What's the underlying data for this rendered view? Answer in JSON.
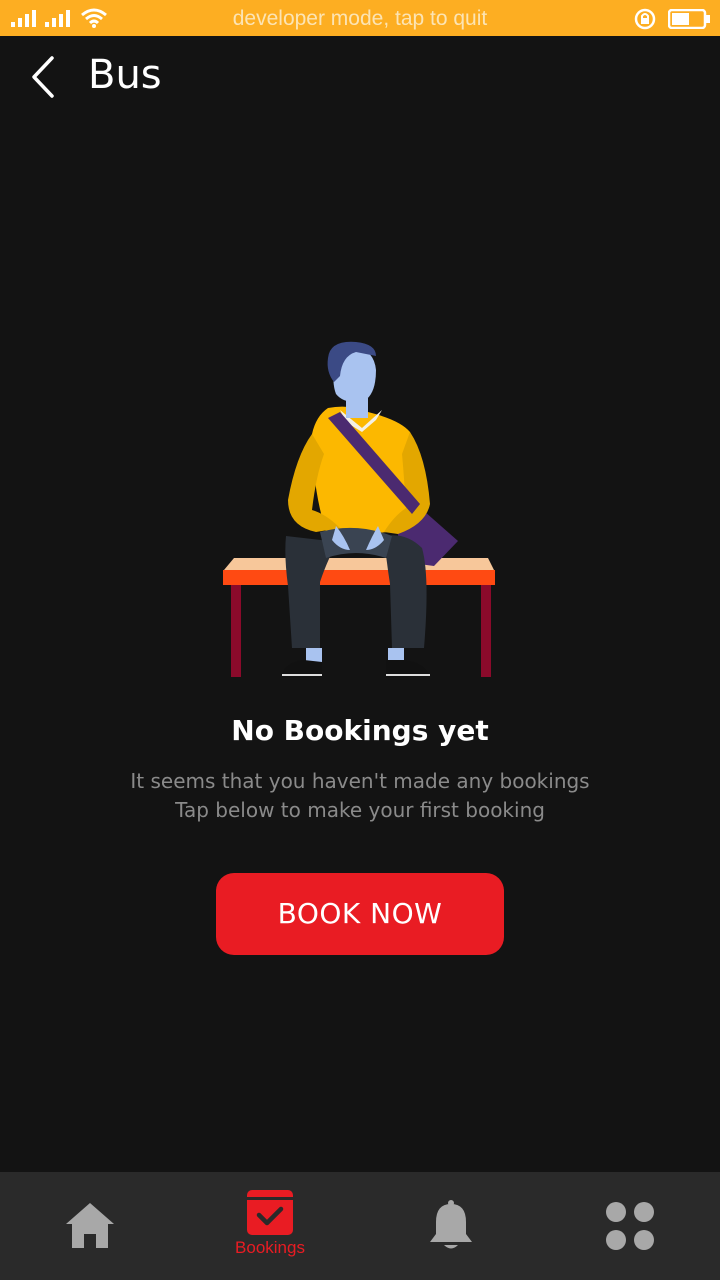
{
  "status_bar": {
    "message": "developer mode, tap to quit",
    "background": "#FDAE22",
    "icons": [
      "signal-icon",
      "signal-icon",
      "wifi-icon",
      "rotation-lock-icon",
      "battery-icon"
    ]
  },
  "header": {
    "back_icon": "chevron-left-icon",
    "title": "Bus"
  },
  "empty_state": {
    "illustration": "man-sitting-on-bench",
    "title": "No Bookings yet",
    "subtitle_line1": "It seems that you haven't made any bookings",
    "subtitle_line2": "Tap below to make your first booking",
    "button_label": "BOOK NOW"
  },
  "bottom_nav": {
    "items": [
      {
        "icon": "home-icon",
        "label": "",
        "active": false
      },
      {
        "icon": "calendar-check-icon",
        "label": "Bookings",
        "active": true
      },
      {
        "icon": "bell-icon",
        "label": "",
        "active": false
      },
      {
        "icon": "grid-dots-icon",
        "label": "",
        "active": false
      }
    ]
  },
  "colors": {
    "accent": "#E91C23",
    "background": "#131313",
    "nav_background": "#2a2a2a",
    "inactive_icon": "#a8a8a8"
  }
}
